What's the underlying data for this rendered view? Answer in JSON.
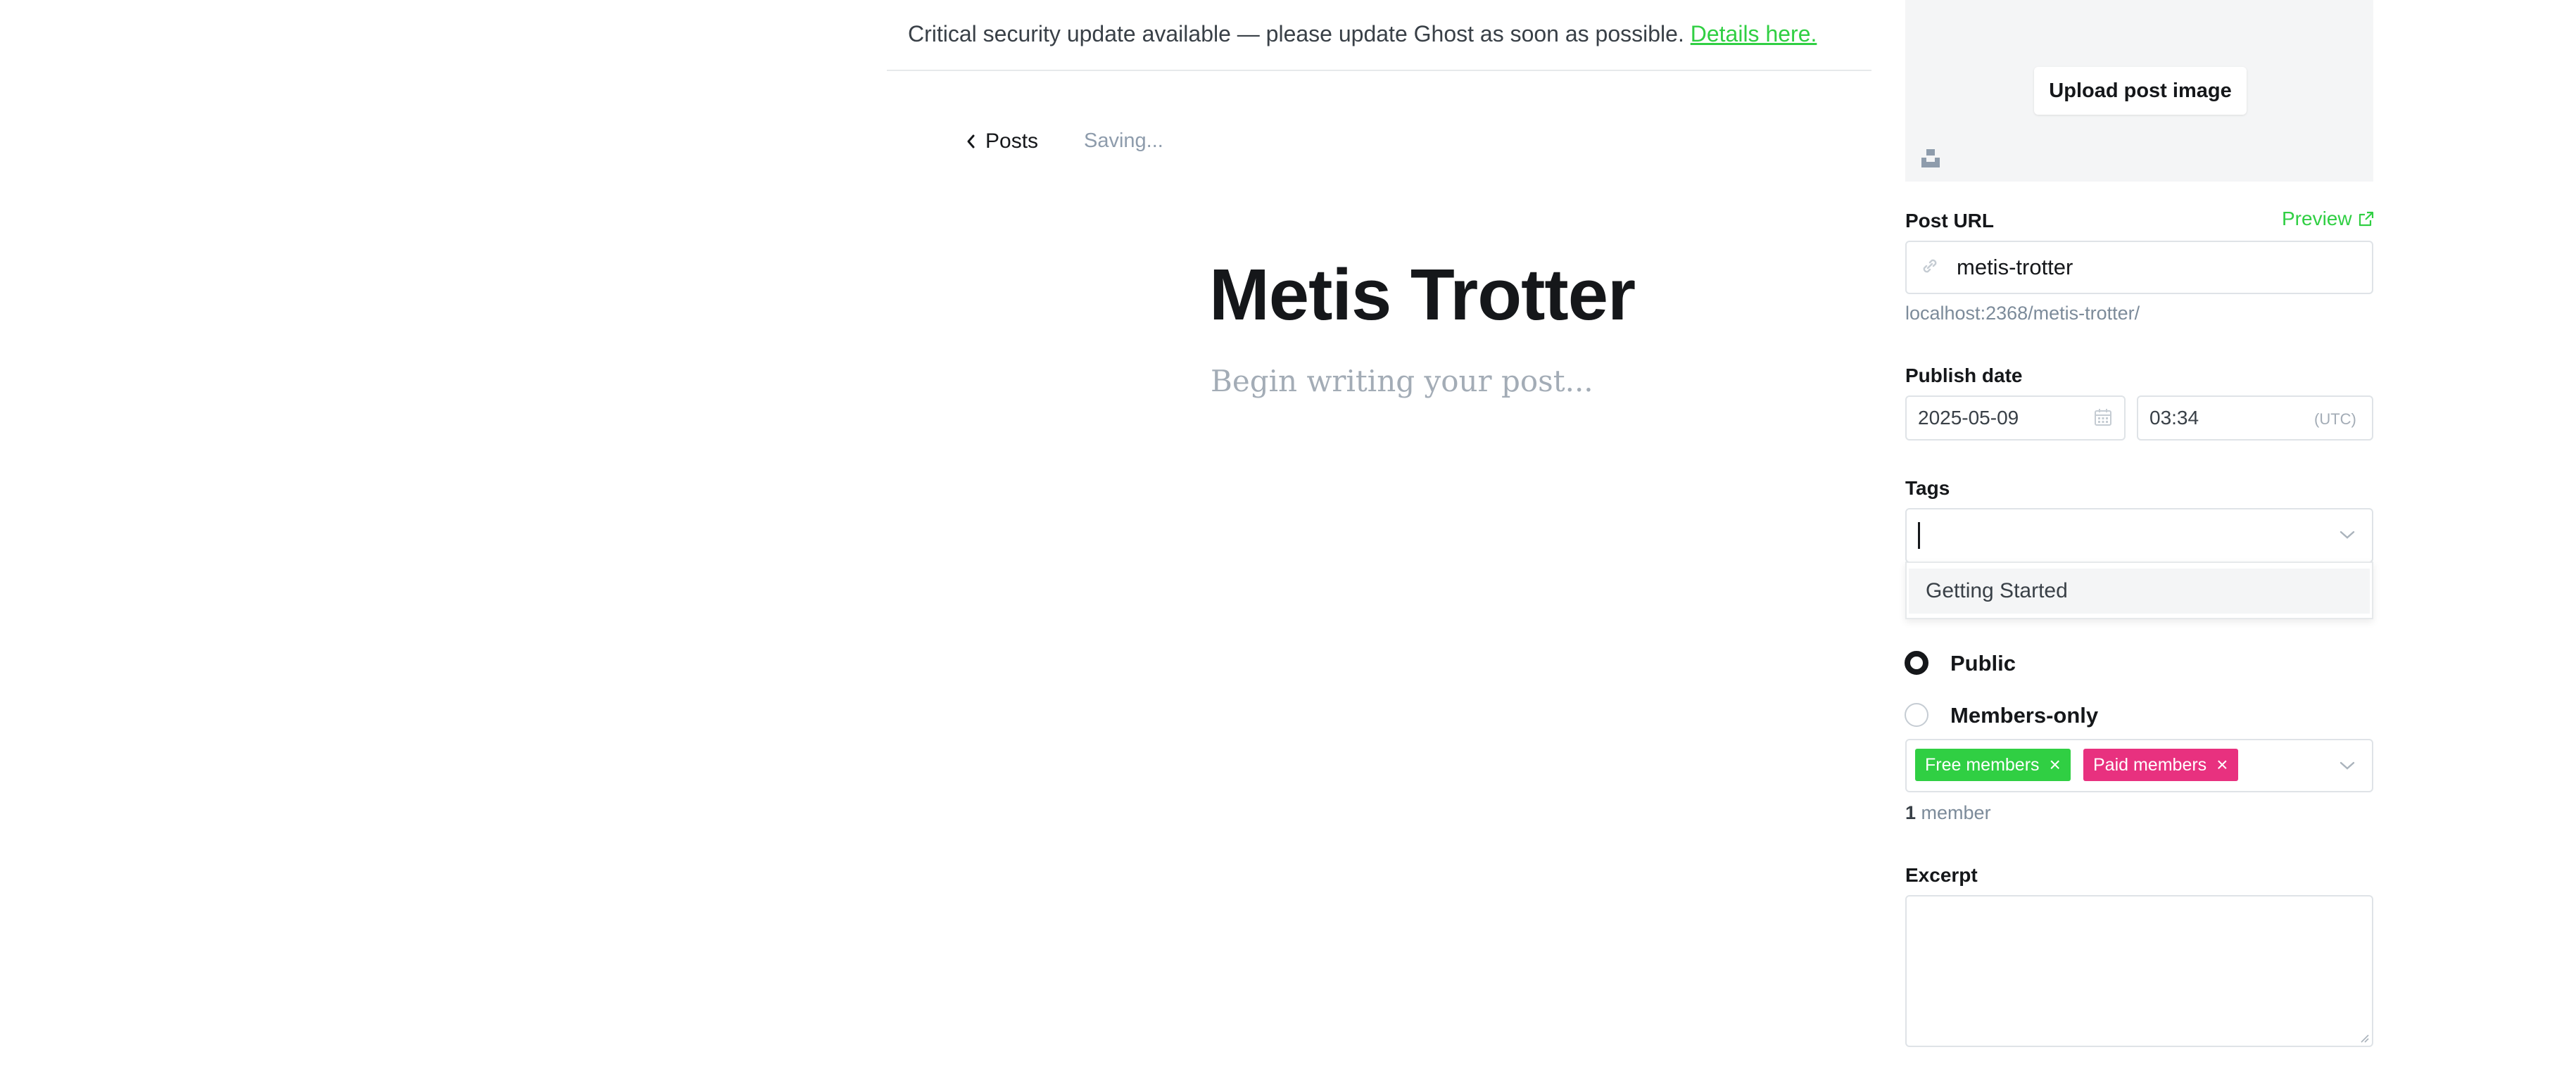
{
  "banner": {
    "message": "Critical security update available — please update Ghost as soon as possible.",
    "link": "Details here."
  },
  "editor_header": {
    "back_label": "Posts",
    "status": "Saving..."
  },
  "editor": {
    "title": "Metis Trotter",
    "body_placeholder": "Begin writing your post..."
  },
  "sidebar": {
    "upload_label": "Upload post image",
    "post_url": {
      "label": "Post URL",
      "preview_label": "Preview",
      "value": "metis-trotter",
      "full_url": "localhost:2368/metis-trotter/"
    },
    "publish_date": {
      "label": "Publish date",
      "date": "2025-05-09",
      "time": "03:34",
      "timezone": "(UTC)"
    },
    "tags": {
      "label": "Tags",
      "value": "",
      "dropdown_options": [
        "Getting Started"
      ]
    },
    "visibility": {
      "options": [
        {
          "label": "Public",
          "selected": true
        },
        {
          "label": "Members-only",
          "selected": false
        }
      ],
      "segments": [
        {
          "label": "Free members",
          "color": "#30cf43"
        },
        {
          "label": "Paid members",
          "color": "#e8317f"
        }
      ],
      "member_count": "1",
      "member_label": "member"
    },
    "excerpt": {
      "label": "Excerpt",
      "value": ""
    }
  },
  "colors": {
    "accent_green": "#30cf43",
    "paid_pink": "#e8317f",
    "text_dark": "#15171a",
    "muted": "#7c8b9a"
  }
}
